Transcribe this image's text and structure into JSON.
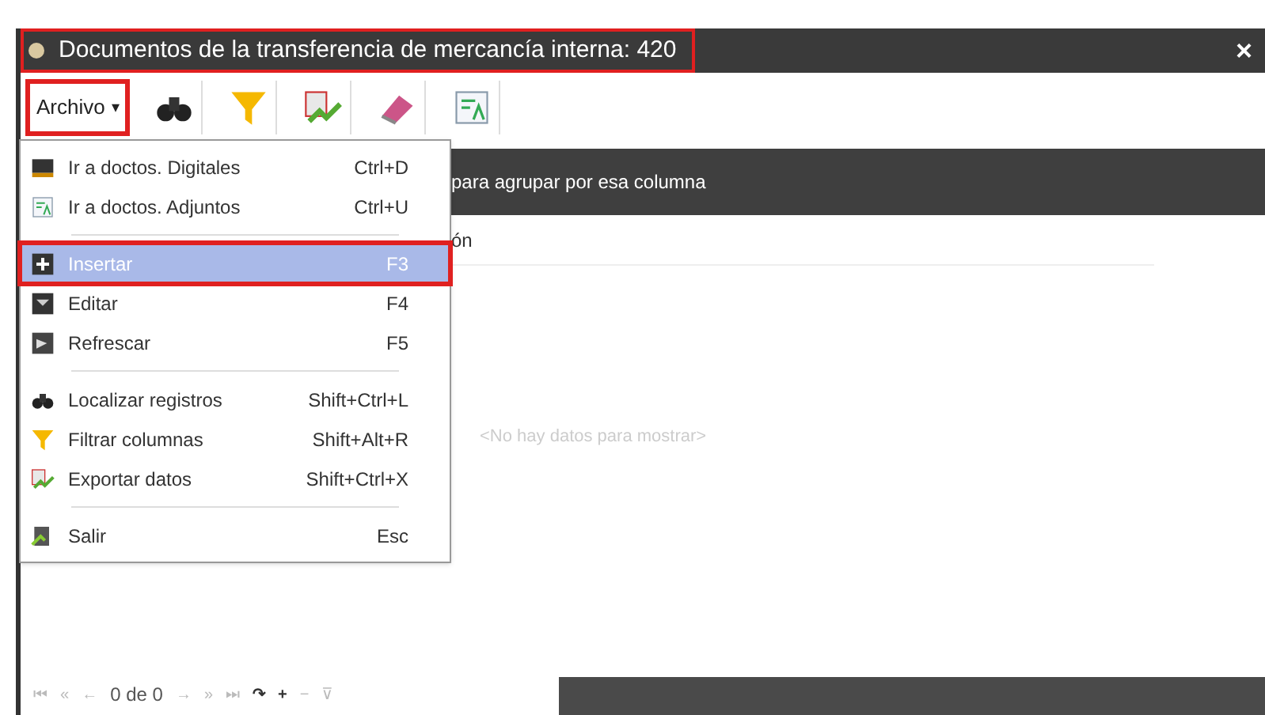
{
  "window": {
    "title": "Documentos de la transferencia de mercancía interna: 420",
    "title_highlighted": true,
    "close": "×"
  },
  "toolbar": {
    "menu_button": {
      "label": "Archivo",
      "caret": "▾",
      "highlighted": true
    },
    "tools": [
      {
        "kind": "binoculars"
      },
      {
        "kind": "filter"
      },
      {
        "kind": "export"
      },
      {
        "kind": "eraser"
      },
      {
        "kind": "text"
      }
    ]
  },
  "menu": {
    "items": [
      {
        "kind": "item",
        "label": "Ir a doctos. Digitales",
        "shortcut": "Ctrl+D",
        "selected": false,
        "highlighted": false
      },
      {
        "kind": "item",
        "label": "Ir a doctos. Adjuntos",
        "shortcut": "Ctrl+U",
        "selected": false,
        "highlighted": false
      },
      {
        "kind": "separator"
      },
      {
        "kind": "item",
        "label": "Insertar",
        "shortcut": "F3",
        "selected": true,
        "highlighted": true
      },
      {
        "kind": "item",
        "label": "Editar",
        "shortcut": "F4",
        "selected": false,
        "highlighted": false
      },
      {
        "kind": "item",
        "label": "Refrescar",
        "shortcut": "F5",
        "selected": false,
        "highlighted": false
      },
      {
        "kind": "separator"
      },
      {
        "kind": "item",
        "label": "Localizar registros",
        "shortcut": "Shift+Ctrl+L",
        "selected": false,
        "highlighted": false
      },
      {
        "kind": "item",
        "label": "Filtrar columnas",
        "shortcut": "Shift+Alt+R",
        "selected": false,
        "highlighted": false
      },
      {
        "kind": "item",
        "label": "Exportar datos",
        "shortcut": "Shift+Ctrl+X",
        "selected": false,
        "highlighted": false
      },
      {
        "kind": "separator"
      },
      {
        "kind": "item",
        "label": "Salir",
        "shortcut": "Esc",
        "selected": false,
        "highlighted": false
      }
    ]
  },
  "grid": {
    "group_panel_text": "para agrupar por esa columna",
    "column_1": "ón",
    "empty_text": "<No hay datos para mostrar>"
  },
  "navigator": {
    "first": "⏮",
    "prev_page": "«",
    "prev": "←",
    "position": "0 de 0",
    "next": "→",
    "next_page": "»",
    "last": "⏭",
    "extra": [
      "↷",
      "+",
      "−",
      "⊽"
    ]
  }
}
